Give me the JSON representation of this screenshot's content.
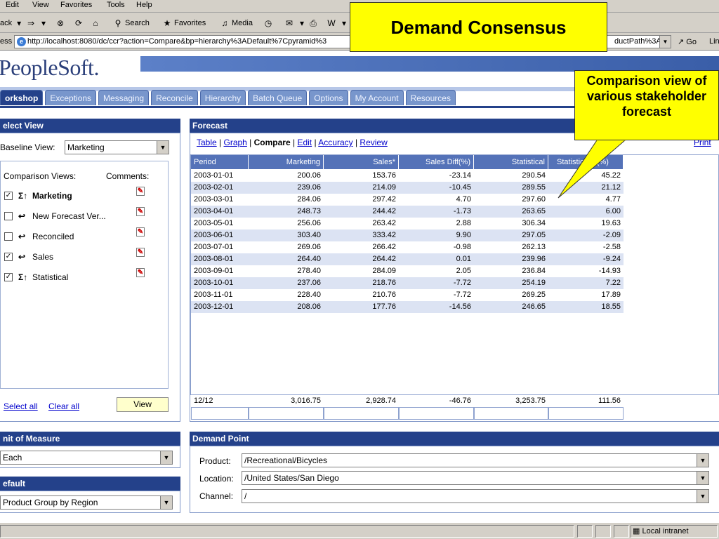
{
  "browser": {
    "menu": [
      "Edit",
      "View",
      "Favorites",
      "Tools",
      "Help"
    ],
    "toolbar": {
      "back": "ack",
      "search": "Search",
      "favorites": "Favorites",
      "media": "Media"
    },
    "address_label": "ess",
    "address_left": "http://localhost:8080/dc/ccr?action=Compare&bp=hierarchy%3ADefault%7Cpyramid%3",
    "address_right": "ductPath%3A/",
    "go": "Go",
    "links": "Lin"
  },
  "callouts": {
    "title": "Demand Consensus",
    "note": "Comparison view of various stakeholder forecast"
  },
  "app": {
    "logo": "PeopleSoft.",
    "tabs": [
      "orkshop",
      "Exceptions",
      "Messaging",
      "Reconcile",
      "Hierarchy",
      "Batch Queue",
      "Options",
      "My Account",
      "Resources"
    ]
  },
  "select_view": {
    "title": "elect View",
    "baseline_label": "Baseline View:",
    "baseline_value": "Marketing",
    "comparison_label": "Comparison Views:",
    "comments_label": "Comments:",
    "items": [
      {
        "checked": "✓",
        "symbol": "Σ↑",
        "label": "Marketing",
        "bold": true
      },
      {
        "checked": "",
        "symbol": "↩",
        "label": "New Forecast Ver...",
        "bold": false
      },
      {
        "checked": "",
        "symbol": "↩",
        "label": "Reconciled",
        "bold": false
      },
      {
        "checked": "✓",
        "symbol": "↩",
        "label": "Sales",
        "bold": false
      },
      {
        "checked": "✓",
        "symbol": "Σ↑",
        "label": "Statistical",
        "bold": false
      }
    ],
    "select_all": "Select all",
    "clear_all": "Clear all",
    "view_button": "View"
  },
  "unit_of_measure": {
    "title": "nit of Measure",
    "value": "Each"
  },
  "default": {
    "title": "efault",
    "value": "Product Group by Region"
  },
  "forecast": {
    "title": "Forecast",
    "nav": {
      "table": "Table",
      "graph": "Graph",
      "compare": "Compare",
      "edit": "Edit",
      "accuracy": "Accuracy",
      "review": "Review",
      "print": "Print"
    },
    "columns": [
      "Period",
      "Marketing",
      "Sales*",
      "Sales Diff(%)",
      "Statistical",
      "Statistic",
      "(%)"
    ],
    "rows": [
      [
        "2003-01-01",
        "200.06",
        "153.76",
        "-23.14",
        "290.54",
        "45.22"
      ],
      [
        "2003-02-01",
        "239.06",
        "214.09",
        "-10.45",
        "289.55",
        "21.12"
      ],
      [
        "2003-03-01",
        "284.06",
        "297.42",
        "4.70",
        "297.60",
        "4.77"
      ],
      [
        "2003-04-01",
        "248.73",
        "244.42",
        "-1.73",
        "263.65",
        "6.00"
      ],
      [
        "2003-05-01",
        "256.06",
        "263.42",
        "2.88",
        "306.34",
        "19.63"
      ],
      [
        "2003-06-01",
        "303.40",
        "333.42",
        "9.90",
        "297.05",
        "-2.09"
      ],
      [
        "2003-07-01",
        "269.06",
        "266.42",
        "-0.98",
        "262.13",
        "-2.58"
      ],
      [
        "2003-08-01",
        "264.40",
        "264.42",
        "0.01",
        "239.96",
        "-9.24"
      ],
      [
        "2003-09-01",
        "278.40",
        "284.09",
        "2.05",
        "236.84",
        "-14.93"
      ],
      [
        "2003-10-01",
        "237.06",
        "218.76",
        "-7.72",
        "254.19",
        "7.22"
      ],
      [
        "2003-11-01",
        "228.40",
        "210.76",
        "-7.72",
        "269.25",
        "17.89"
      ],
      [
        "2003-12-01",
        "208.06",
        "177.76",
        "-14.56",
        "246.65",
        "18.55"
      ]
    ],
    "totals": [
      "12/12",
      "3,016.75",
      "2,928.74",
      "-46.76",
      "3,253.75",
      "111.56"
    ]
  },
  "demand_point": {
    "title": "Demand Point",
    "product_label": "Product:",
    "product_value": "/Recreational/Bicycles",
    "location_label": "Location:",
    "location_value": "/United States/San Diego",
    "channel_label": "Channel:",
    "channel_value": "/"
  },
  "status": {
    "zone": "Local intranet"
  }
}
